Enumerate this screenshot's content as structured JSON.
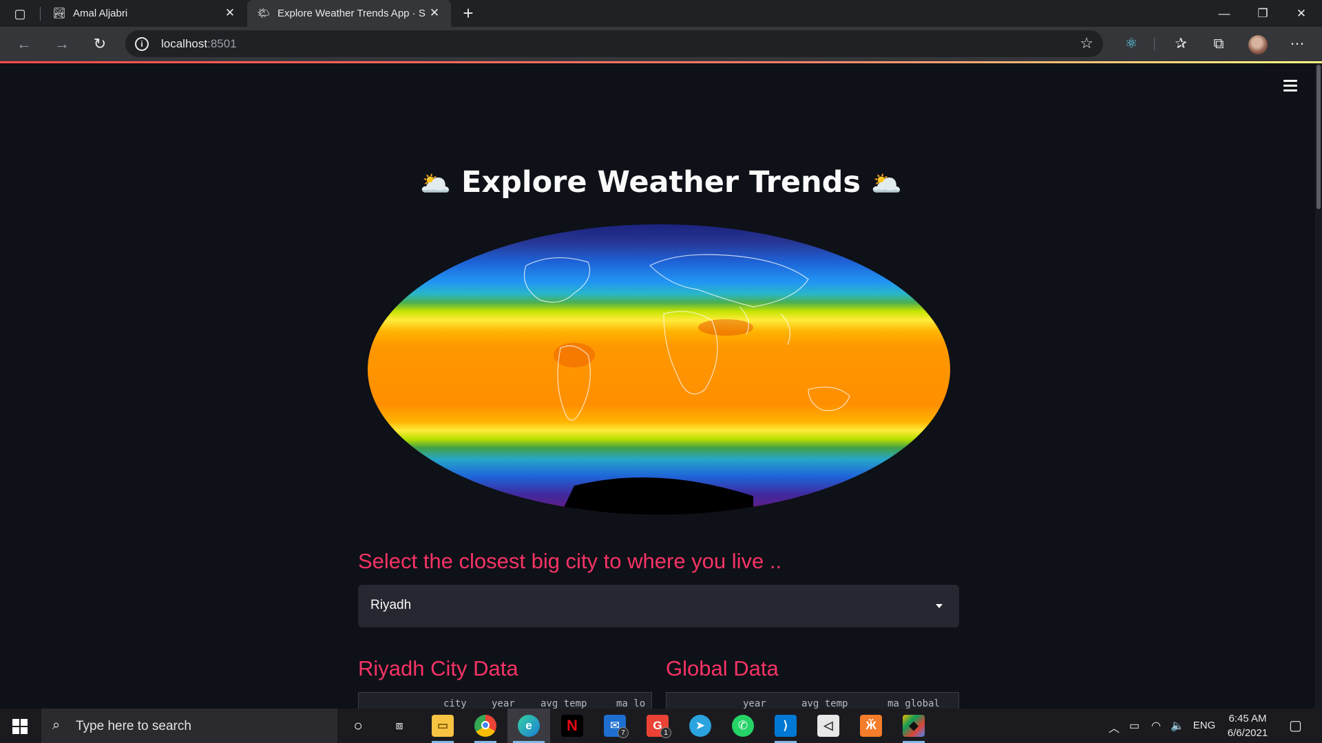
{
  "browser": {
    "tabs": [
      {
        "title": "Amal Aljabri",
        "active": false
      },
      {
        "title": "Explore Weather Trends App · Streamlit",
        "active": true
      }
    ],
    "address": {
      "host": "localhost",
      "port": ":8501"
    }
  },
  "app": {
    "title": "Explore Weather Trends",
    "title_emoji": "🌥️",
    "select_label": "Select the closest big city to where you live ..",
    "selected_city": "Riyadh",
    "city_section_title": "Riyadh City Data",
    "global_section_title": "Global Data",
    "city_table_columns": [
      "city",
      "year",
      "avg_temp",
      "ma_lo"
    ],
    "global_table_columns": [
      "year",
      "avg_temp",
      "ma_global"
    ]
  },
  "taskbar": {
    "search_placeholder": "Type here to search",
    "mail_badge": "7",
    "gmail_badge": "1",
    "language": "ENG",
    "time": "6:45 AM",
    "date": "6/6/2021"
  },
  "colors": {
    "accent": "#f63366",
    "background": "#0e1117",
    "widget": "#262730"
  }
}
